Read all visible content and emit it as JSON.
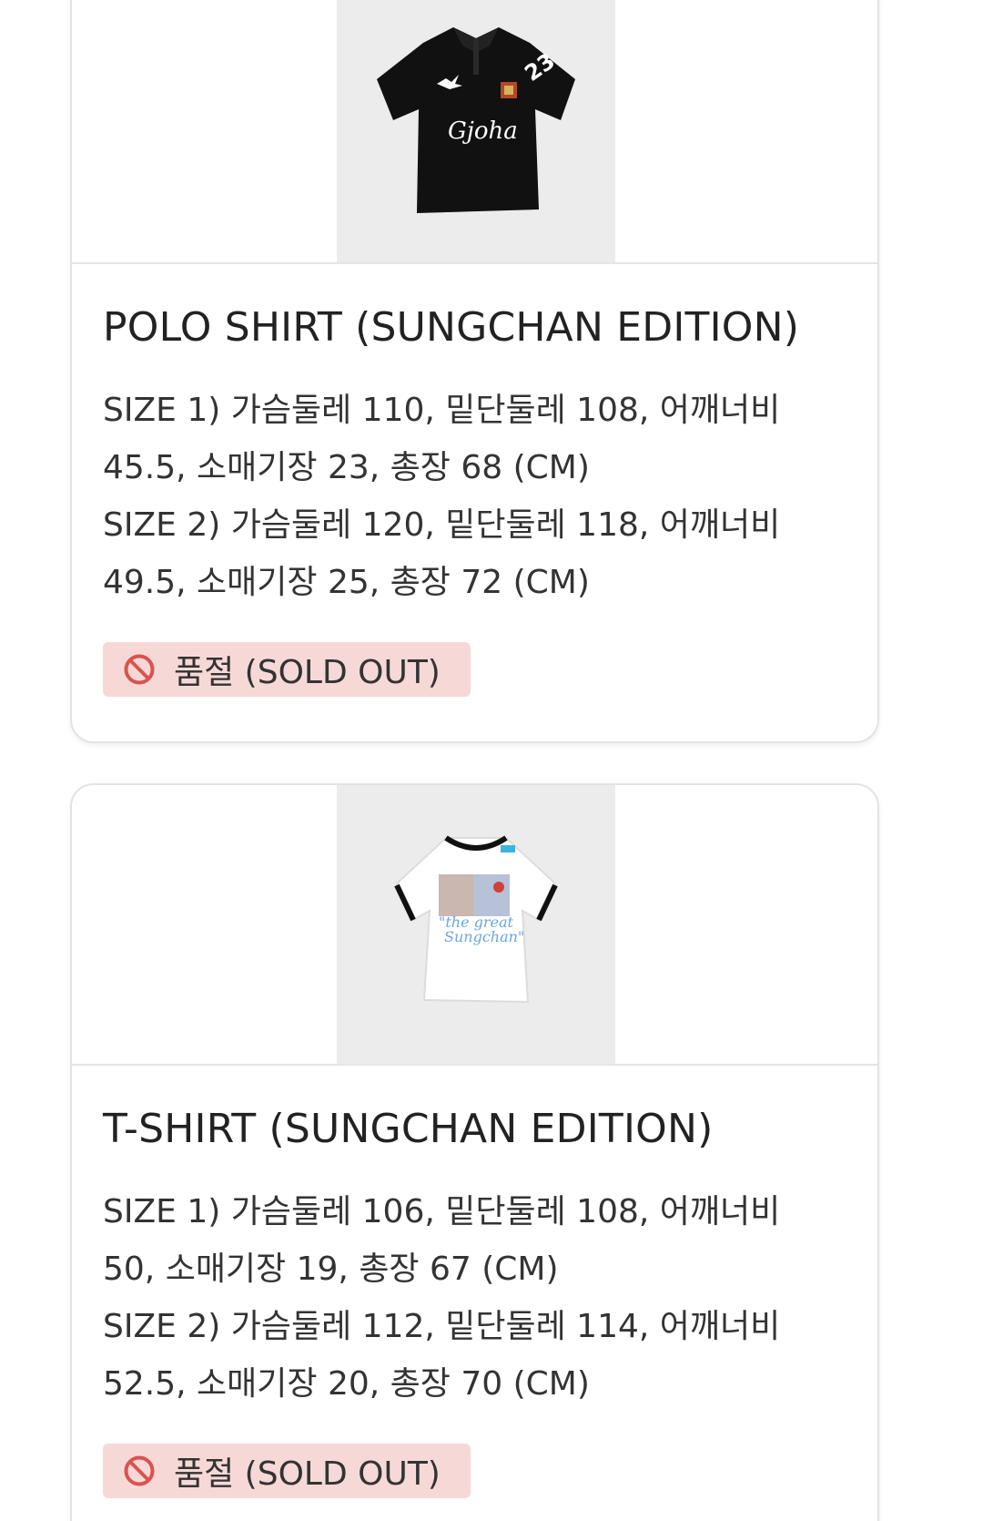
{
  "colors": {
    "card_border": "#e3e3e3",
    "image_panel": "#ececec",
    "badge_bg": "#f6d9d7",
    "badge_icon": "#d9534f",
    "text": "#222222"
  },
  "products": [
    {
      "title": "POLO SHIRT (SUNGCHAN EDITION)",
      "image_icon": "black-polo-shirt-image",
      "sizes": [
        "SIZE 1) 가슴둘레 110, 밑단둘레 108, 어깨너비 45.5, 소매기장 23, 총장 68 (CM)",
        "SIZE 2) 가슴둘레 120, 밑단둘레 118, 어깨너비 49.5, 소매기장 25, 총장 72 (CM)"
      ],
      "status_icon": "prohibited-icon",
      "status_label": "품절 (SOLD OUT)"
    },
    {
      "title": "T-SHIRT (SUNGCHAN EDITION)",
      "image_icon": "white-ringer-tshirt-image",
      "sizes": [
        "SIZE 1) 가슴둘레 106, 밑단둘레 108, 어깨너비 50, 소매기장 19, 총장 67 (CM)",
        "SIZE 2) 가슴둘레 112, 밑단둘레 114, 어깨너비 52.5, 소매기장 20, 총장 70 (CM)"
      ],
      "status_icon": "prohibited-icon",
      "status_label": "품절 (SOLD OUT)"
    }
  ]
}
